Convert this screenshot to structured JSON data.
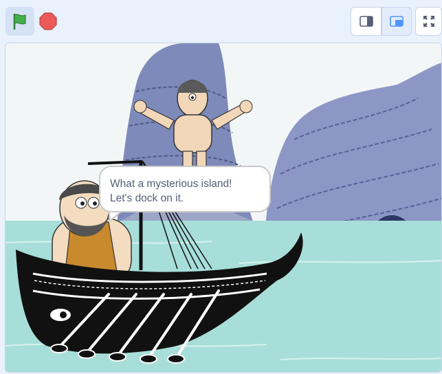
{
  "toolbar": {
    "green_flag_icon": "green-flag-icon",
    "stop_icon": "stop-sign-icon",
    "small_stage_icon": "small-stage-icon",
    "normal_stage_icon": "normal-stage-icon",
    "fullscreen_icon": "fullscreen-icon"
  },
  "stage": {
    "speech_bubble": {
      "line1": "What a mysterious island!",
      "line2": "Let's dock on it."
    }
  },
  "colors": {
    "accent": "#4c97ff",
    "flag": "#45b04b",
    "stop": "#ec5959",
    "sea": "#a7ded9",
    "sky": "#f3f6f6",
    "rock": "#8792c4"
  }
}
